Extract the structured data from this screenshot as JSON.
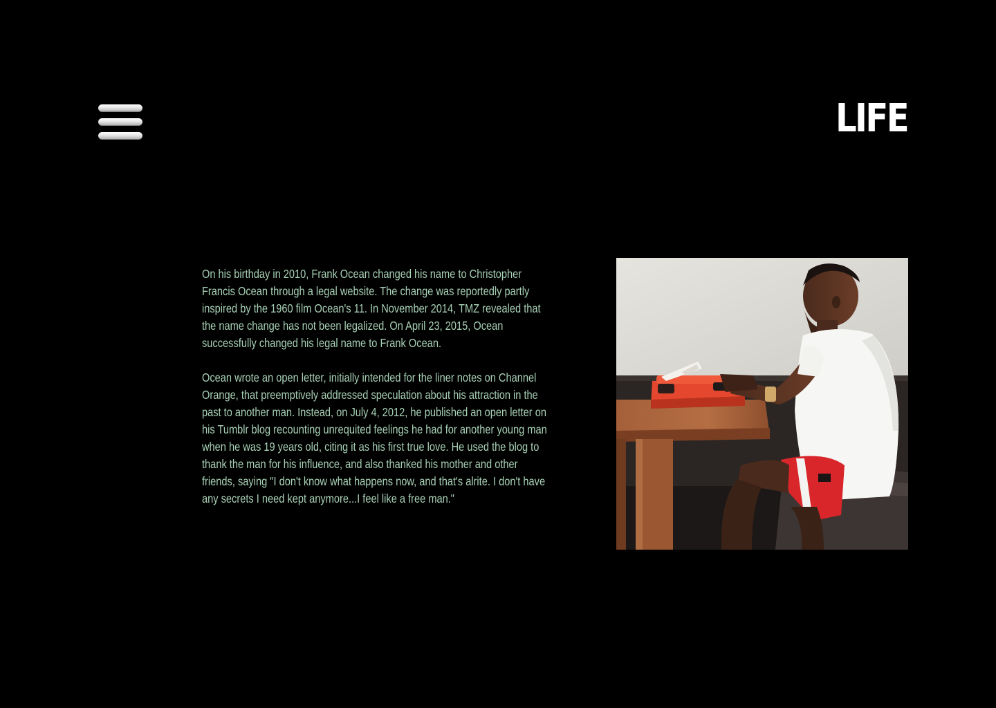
{
  "header": {
    "title": "LIFE",
    "menu_icon": "hamburger-menu-icon"
  },
  "content": {
    "paragraphs": [
      "On his birthday in 2010, Frank Ocean changed his name to Christopher Francis Ocean through a legal website. The change was reportedly partly inspired by the 1960 film Ocean's 11. In November 2014, TMZ revealed that the name change has not been legalized. On April 23, 2015, Ocean successfully changed his legal name to Frank Ocean.",
      "Ocean wrote an open letter, initially intended for the liner notes on Channel Orange, that preemptively addressed speculation about his attraction in the past to another man. Instead, on July 4, 2012, he published an open letter on his Tumblr blog recounting unrequited feelings he had for another young man when he was 19 years old, citing it as his first true love. He used the blog to thank the man for his influence, and also thanked his mother and other friends, saying \"I don't know what happens now, and that's alrite. I don't have any secrets I need kept anymore...I feel like a free man.\""
    ],
    "photo_subject": "man-typing-on-red-typewriter"
  },
  "colors": {
    "background": "#000000",
    "title": "#ffffff",
    "body_text": "#a8d1b6",
    "typewriter": "#e4472d",
    "shorts": "#d8262a"
  }
}
